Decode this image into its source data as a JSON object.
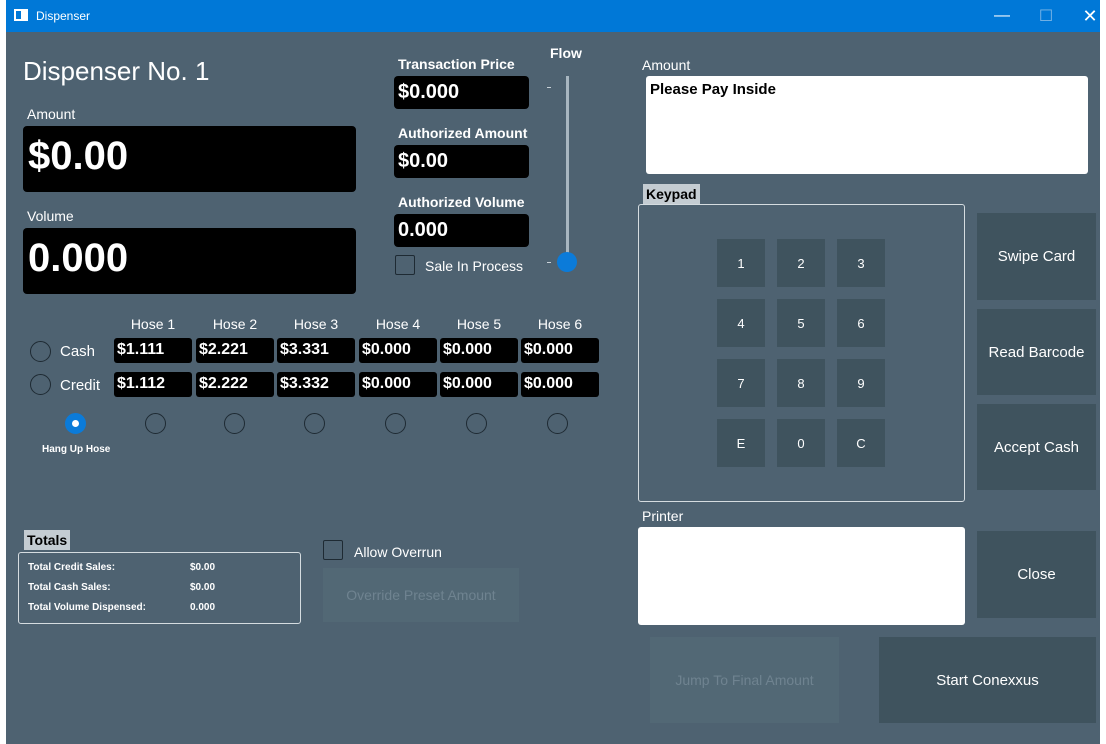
{
  "window": {
    "title": "Dispenser",
    "controls": {
      "minimize": "—",
      "maximize": "☐",
      "close": "✕"
    }
  },
  "dispenser": {
    "title": "Dispenser No. 1",
    "amount_label": "Amount",
    "amount_value": "$0.00",
    "volume_label": "Volume",
    "volume_value": "0.000"
  },
  "transaction": {
    "price_label": "Transaction Price",
    "price_value": "$0.000",
    "auth_amount_label": "Authorized Amount",
    "auth_amount_value": "$0.00",
    "auth_volume_label": "Authorized Volume",
    "auth_volume_value": "0.000",
    "sale_in_process_label": "Sale In Process",
    "sale_in_process_checked": false
  },
  "flow": {
    "label": "Flow",
    "level": 0.0
  },
  "hoses": {
    "headers": [
      "Hose 1",
      "Hose 2",
      "Hose 3",
      "Hose 4",
      "Hose 5",
      "Hose 6"
    ],
    "cash_label": "Cash",
    "credit_label": "Credit",
    "cash_prices": [
      "$1.111",
      "$2.221",
      "$3.331",
      "$0.000",
      "$0.000",
      "$0.000"
    ],
    "credit_prices": [
      "$1.112",
      "$2.222",
      "$3.332",
      "$0.000",
      "$0.000",
      "$0.000"
    ],
    "hang_up_label": "Hang Up Hose",
    "selected_index": 0
  },
  "totals": {
    "title": "Totals",
    "credit_sales_label": "Total Credit Sales:",
    "credit_sales_value": "$0.00",
    "cash_sales_label": "Total Cash Sales:",
    "cash_sales_value": "$0.00",
    "volume_label": "Total Volume Dispensed:",
    "volume_value": "0.000"
  },
  "overrun": {
    "allow_label": "Allow Overrun",
    "override_button": "Override Preset Amount"
  },
  "right_panel": {
    "amount_label": "Amount",
    "amount_message": "Please Pay Inside",
    "keypad_title": "Keypad",
    "keys": [
      "1",
      "2",
      "3",
      "4",
      "5",
      "6",
      "7",
      "8",
      "9",
      "E",
      "0",
      "C"
    ],
    "printer_label": "Printer",
    "swipe_card": "Swipe Card",
    "read_barcode": "Read Barcode",
    "accept_cash": "Accept Cash",
    "close": "Close",
    "jump_final": "Jump To Final Amount",
    "start_conexxus": "Start Conexxus"
  }
}
